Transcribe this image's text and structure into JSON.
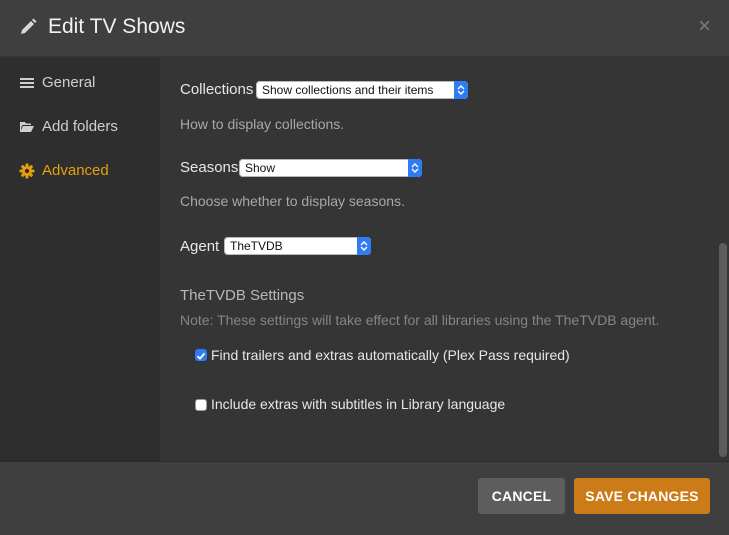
{
  "dialog": {
    "title": "Edit TV Shows",
    "title_icon": "pencil-icon",
    "close_glyph": "×",
    "close_icon": "close-icon"
  },
  "sidebar": {
    "items": [
      {
        "label": "General",
        "icon": "list-icon",
        "active": false
      },
      {
        "label": "Add folders",
        "icon": "folder-icon",
        "active": false
      },
      {
        "label": "Advanced",
        "icon": "gear-icon",
        "active": true
      }
    ]
  },
  "settings": {
    "collections": {
      "label": "Collections",
      "value": "Show collections and their items",
      "help": "How to display collections."
    },
    "seasons": {
      "label": "Seasons",
      "value": "Show",
      "help": "Choose whether to display seasons."
    },
    "agent": {
      "label": "Agent",
      "value": "TheTVDB"
    },
    "agent_settings": {
      "title": "TheTVDB Settings",
      "note": "Note: These settings will take effect for all libraries using the TheTVDB agent.",
      "options": [
        {
          "label": "Find trailers and extras automatically (Plex Pass required)",
          "checked": true
        },
        {
          "label": "Include extras with subtitles in Library language",
          "checked": false
        }
      ]
    }
  },
  "footer": {
    "cancel_label": "CANCEL",
    "save_label": "SAVE CHANGES"
  },
  "colors": {
    "accent": "#e5a00d",
    "save_button": "#cc7b19",
    "cancel_button": "#5d5d5d",
    "select_accent": "#2f7bf2"
  }
}
